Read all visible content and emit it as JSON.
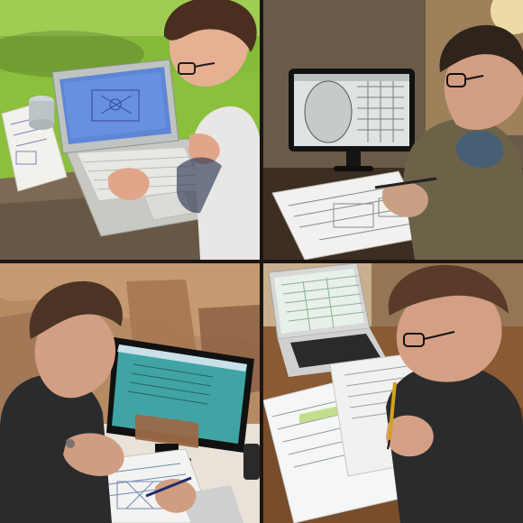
{
  "image": {
    "layout": "2x2-collage",
    "panels": [
      {
        "scene": "outdoor-lawn",
        "device": "laptop",
        "activity": "typing"
      },
      {
        "scene": "indoor-desk",
        "device": "monitor",
        "activity": "sketching-on-paper"
      },
      {
        "scene": "ruins",
        "device": "monitor",
        "activity": "writing-on-plan"
      },
      {
        "scene": "indoor-table",
        "device": "laptop",
        "activity": "writing-in-notebook"
      }
    ],
    "colors": {
      "grass": "#8bbf3c",
      "stone": "#7c6a55",
      "shirt_white": "#e9e7e6",
      "hoodie_olive": "#6b6248",
      "sandstone": "#b68b63",
      "tshirt_dark": "#2a2b2d",
      "wood": "#8a5a33",
      "screen_blue": "#5e86d6",
      "screen_teal": "#40a4a5"
    }
  }
}
